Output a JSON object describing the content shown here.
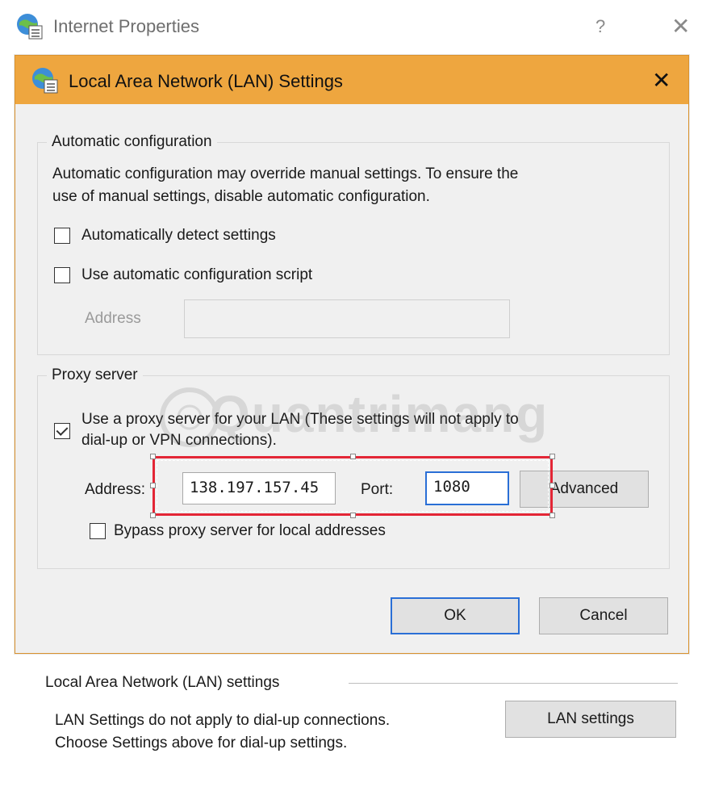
{
  "parent_window": {
    "title": "Internet Properties",
    "help_label": "?",
    "close_label": "✕"
  },
  "dialog": {
    "title": "Local Area Network (LAN) Settings",
    "close_label": "✕",
    "accent_color": "#eea63f"
  },
  "automatic_configuration": {
    "legend": "Automatic configuration",
    "description_line1": "Automatic configuration may override manual settings.  To ensure the",
    "description_line2": "use of manual settings, disable automatic configuration.",
    "detect_settings_label": "Automatically detect settings",
    "detect_settings_checked": false,
    "use_script_label": "Use automatic configuration script",
    "use_script_checked": false,
    "address_label": "Address",
    "address_value": ""
  },
  "proxy_server": {
    "legend": "Proxy server",
    "use_proxy_label_line1": "Use a proxy server for your LAN (These settings will not apply to",
    "use_proxy_label_line2": "dial-up or VPN connections).",
    "use_proxy_checked": true,
    "address_label": "Address:",
    "address_value": "138.197.157.45",
    "port_label": "Port:",
    "port_value": "1080",
    "advanced_label": "Advanced",
    "bypass_label": "Bypass proxy server for local addresses",
    "bypass_checked": false
  },
  "buttons": {
    "ok_label": "OK",
    "cancel_label": "Cancel"
  },
  "lan_section": {
    "label": "Local Area Network (LAN) settings",
    "description_line1": "LAN Settings do not apply to dial-up connections.",
    "description_line2": "Choose Settings above for dial-up settings.",
    "button_label": "LAN settings"
  },
  "watermark": {
    "text": "Quantrimang"
  },
  "icons": {
    "window_icon": "globe-settings-icon",
    "highlight_color": "#e32636"
  }
}
